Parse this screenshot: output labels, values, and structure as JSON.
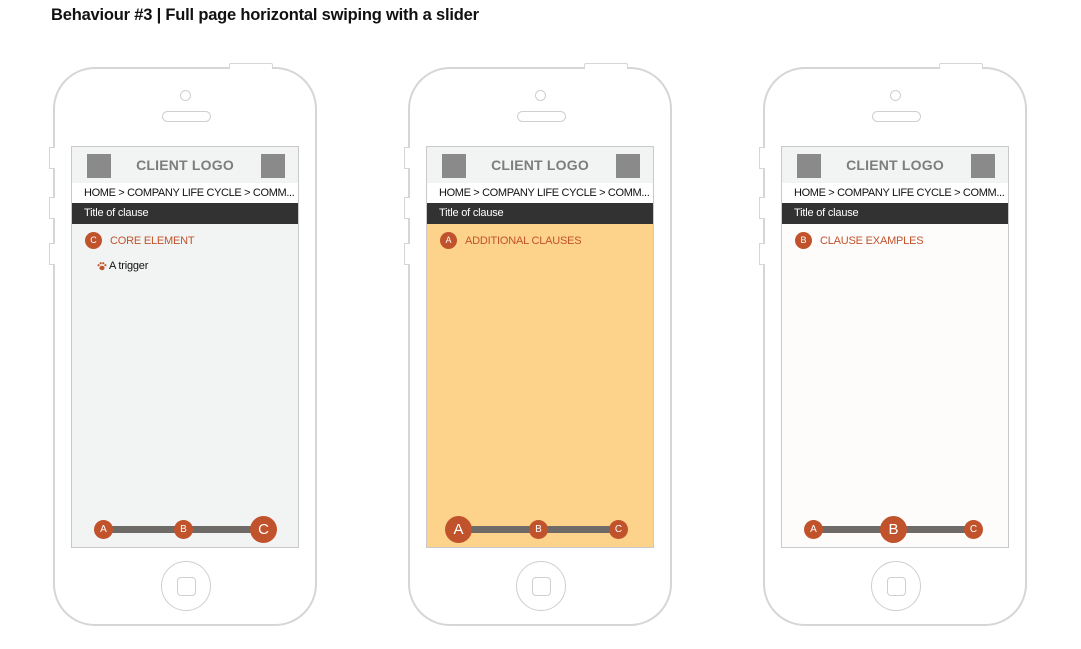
{
  "title": "Behaviour #3 | Full page horizontal swiping with a slider",
  "colors": {
    "accent": "#c0532c",
    "title_bar": "#323232",
    "slider_track": "#6e6a67",
    "logo_square": "#8a8a8a"
  },
  "phones": [
    {
      "screen_bg": "#f2f4f4",
      "logo": "CLIENT LOGO",
      "breadcrumb": "HOME > COMPANY LIFE CYCLE > COMM...",
      "clause_title": "Title of clause",
      "section_badge": "C",
      "section_label": "CORE ELEMENT",
      "trigger_label": "A trigger",
      "slider": {
        "a": "A",
        "b": "B",
        "c": "C",
        "active": "C"
      }
    },
    {
      "screen_bg": "#fdd28b",
      "logo": "CLIENT LOGO",
      "breadcrumb": "HOME > COMPANY LIFE CYCLE > COMM...",
      "clause_title": "Title of clause",
      "section_badge": "A",
      "section_label": "ADDITIONAL CLAUSES",
      "slider": {
        "a": "A",
        "b": "B",
        "c": "C",
        "active": "A"
      }
    },
    {
      "screen_bg": "#fefcfa",
      "logo": "CLIENT LOGO",
      "breadcrumb": "HOME > COMPANY LIFE CYCLE > COMM...",
      "clause_title": "Title of clause",
      "section_badge": "B",
      "section_label": "CLAUSE EXAMPLES",
      "slider": {
        "a": "A",
        "b": "B",
        "c": "C",
        "active": "B"
      }
    }
  ]
}
